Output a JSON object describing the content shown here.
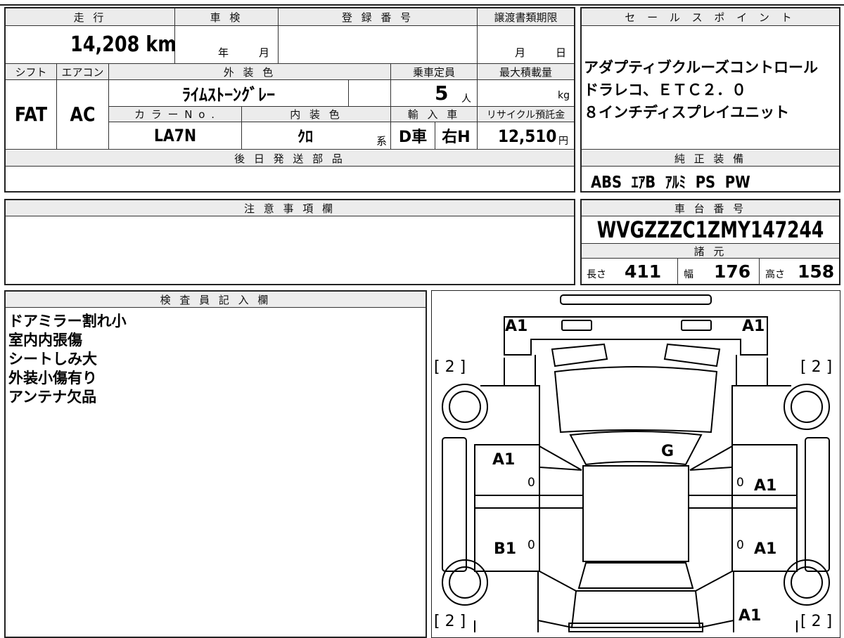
{
  "left_panel": {
    "headers": {
      "mileage": "走 行",
      "inspection": "車 検",
      "registration": "登 録 番 号",
      "transfer_deadline": "譲渡書類期限",
      "shift": "シフト",
      "aircon": "エアコン",
      "exterior_color": "外 装 色",
      "capacity": "乗車定員",
      "max_load": "最大積載量",
      "color_no": "カ ラ ー N o .",
      "interior_color": "内 装 色",
      "import": "輸 入 車",
      "recycle": "リサイクル預託金",
      "later_parts": "後 日 発 送 部 品"
    },
    "mileage_value": "14,208 km",
    "inspection_year": "年",
    "inspection_month": "月",
    "transfer_month": "月",
    "transfer_day": "日",
    "shift_value": "FAT",
    "aircon_value": "AC",
    "exterior_color_value": "ﾗｲﾑｽﾄｰﾝｸﾞﾚｰ",
    "capacity_value": "5",
    "capacity_unit": "人",
    "load_unit": "kg",
    "color_no_value": "LA7N",
    "interior_color_value": "ｸﾛ",
    "interior_color_suffix": "系",
    "import_value": "D車",
    "steering_value": "右H",
    "recycle_value": "12,510",
    "recycle_unit": "円"
  },
  "sales_points": {
    "header": "セ ー ル ス ポ イ ン ト",
    "lines": [
      "アダプティブクルーズコントロール",
      "ドラレコ、ＥＴＣ２．０",
      "８インチディスプレイユニット"
    ]
  },
  "equipment": {
    "header": "純 正 装 備",
    "value": "ABS  ｴｱB  ｱﾙﾐ  PS  PW"
  },
  "notes": {
    "header": "注 意 事 項 欄"
  },
  "chassis": {
    "header": "車 台 番 号",
    "value": "WVGZZZC1ZMY147244",
    "spec_header": "諸 元",
    "length_label": "長さ",
    "length_value": "411",
    "width_label": "幅",
    "width_value": "176",
    "height_label": "高さ",
    "height_value": "158"
  },
  "inspector": {
    "header": "検 査 員 記 入 欄",
    "lines": [
      "ドアミラー割れ小",
      "室内内張傷",
      "シートしみ大",
      "外装小傷有り",
      "アンテナ欠品"
    ]
  },
  "diagram": {
    "marks": {
      "front_left": "A1",
      "front_right": "A1",
      "tire_fl": "[ 2 ]",
      "tire_fr": "[ 2 ]",
      "tire_rl": "[ 2 ]",
      "tire_rr": "[ 2 ]",
      "windshield": "G",
      "door_fl": "A1",
      "door_fl_zero": "0",
      "door_fr": "A1",
      "door_fr_zero": "0",
      "door_rl": "B1",
      "door_rl_zero": "0",
      "door_rr": "A1",
      "door_rr_zero": "0",
      "rear_right": "A1"
    }
  }
}
